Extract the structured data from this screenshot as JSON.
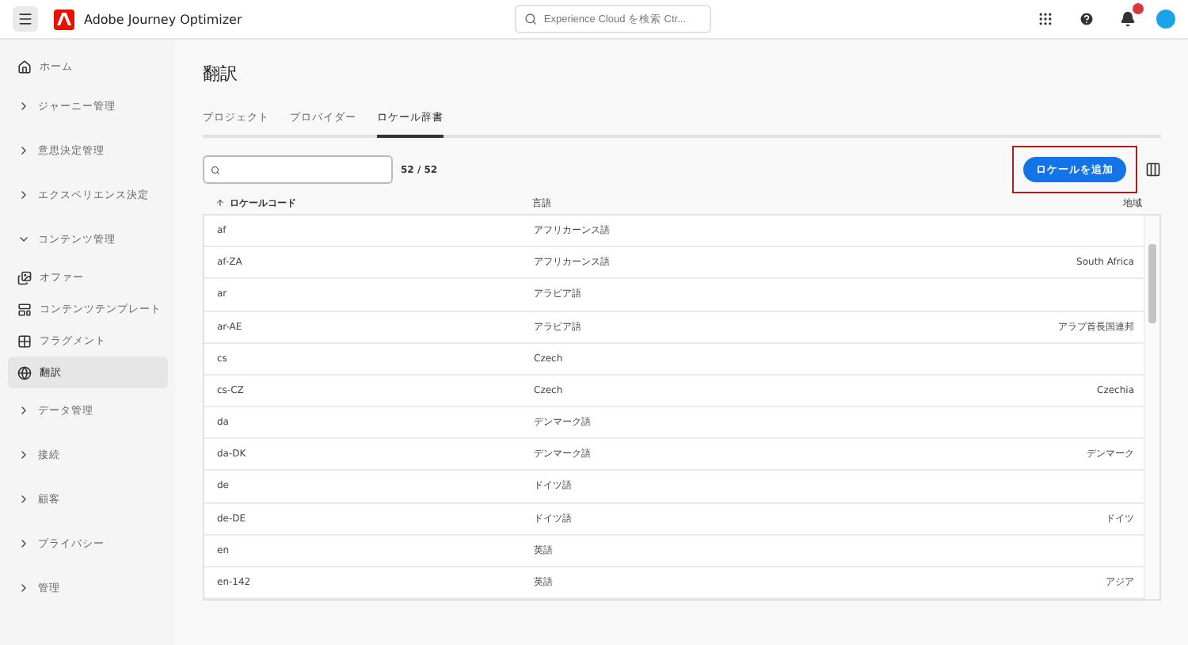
{
  "header": {
    "app_name": "Adobe Journey Optimizer",
    "search": {
      "placeholder": "Experience Cloud を検索 Ctr..."
    }
  },
  "sidebar": {
    "items": [
      {
        "kind": "home",
        "label": "ホーム",
        "selected": false
      },
      {
        "kind": "group",
        "label": "ジャーニー管理",
        "expanded": false
      },
      {
        "kind": "group",
        "label": "意思決定管理",
        "expanded": false
      },
      {
        "kind": "group",
        "label": "エクスペリエンス決定",
        "expanded": false
      },
      {
        "kind": "group",
        "label": "コンテンツ管理",
        "expanded": true,
        "children": [
          {
            "kind": "offers",
            "label": "オファー",
            "selected": false
          },
          {
            "kind": "templates",
            "label": "コンテンツテンプレート",
            "selected": false
          },
          {
            "kind": "fragments",
            "label": "フラグメント",
            "selected": false
          },
          {
            "kind": "translations",
            "label": "翻訳",
            "selected": true
          }
        ]
      },
      {
        "kind": "group",
        "label": "データ管理",
        "expanded": false
      },
      {
        "kind": "group",
        "label": "接続",
        "expanded": false
      },
      {
        "kind": "group",
        "label": "顧客",
        "expanded": false
      },
      {
        "kind": "group",
        "label": "プライバシー",
        "expanded": false
      },
      {
        "kind": "group",
        "label": "管理",
        "expanded": false
      }
    ]
  },
  "page": {
    "title": "翻訳",
    "tabs": [
      {
        "label": "プロジェクト",
        "selected": false
      },
      {
        "label": "プロバイダー",
        "selected": false
      },
      {
        "label": "ロケール辞書",
        "selected": true
      }
    ],
    "count": "52 / 52",
    "add_button": "ロケールを追加",
    "table": {
      "columns": [
        "ロケールコード",
        "言語",
        "地域"
      ],
      "rows": [
        [
          "af",
          "アフリカーンス語",
          ""
        ],
        [
          "af-ZA",
          "アフリカーンス語",
          "South Africa"
        ],
        [
          "ar",
          "アラビア語",
          ""
        ],
        [
          "ar-AE",
          "アラビア語",
          "アラブ首長国連邦"
        ],
        [
          "cs",
          "Czech",
          ""
        ],
        [
          "cs-CZ",
          "Czech",
          "Czechia"
        ],
        [
          "da",
          "デンマーク語",
          ""
        ],
        [
          "da-DK",
          "デンマーク語",
          "デンマーク"
        ],
        [
          "de",
          "ドイツ語",
          ""
        ],
        [
          "de-DE",
          "ドイツ語",
          "ドイツ"
        ],
        [
          "en",
          "英語",
          ""
        ],
        [
          "en-142",
          "英語",
          "アジア"
        ]
      ]
    }
  }
}
